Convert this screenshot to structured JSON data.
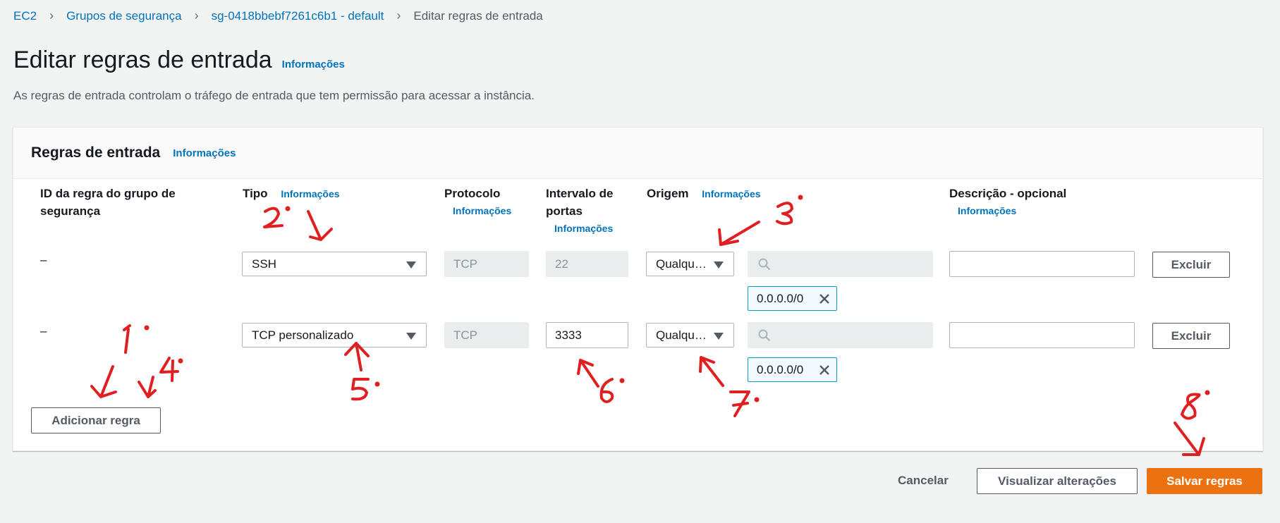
{
  "breadcrumb": {
    "items": [
      "EC2",
      "Grupos de segurança",
      "sg-0418bbebf7261c6b1 - default",
      "Editar regras de entrada"
    ]
  },
  "header": {
    "title": "Editar regras de entrada",
    "info": "Informações",
    "description": "As regras de entrada controlam o tráfego de entrada que tem permissão para acessar a instância."
  },
  "panel": {
    "title": "Regras de entrada",
    "info": "Informações",
    "columns": {
      "rule_id": "ID da regra do grupo de segurança",
      "type": "Tipo",
      "protocol": "Protocolo",
      "port_range": "Intervalo de portas",
      "source": "Origem",
      "description": "Descrição - opcional",
      "info": "Informações"
    },
    "rows": [
      {
        "id": "–",
        "type": "SSH",
        "protocol": "TCP",
        "port": "22",
        "source": "Qualqu…",
        "search": "",
        "cidr": "0.0.0.0/0",
        "description": "",
        "delete": "Excluir"
      },
      {
        "id": "–",
        "type": "TCP personalizado",
        "protocol": "TCP",
        "port": "3333",
        "source": "Qualqu…",
        "search": "",
        "cidr": "0.0.0.0/0",
        "description": "",
        "delete": "Excluir"
      }
    ],
    "add_rule": "Adicionar regra"
  },
  "footer": {
    "cancel": "Cancelar",
    "preview": "Visualizar alterações",
    "save": "Salvar regras"
  },
  "annotations": {
    "color": "#e02020",
    "labels": [
      "1.",
      "2.",
      "3.",
      "4.",
      "5.",
      "6.",
      "7.",
      "8."
    ]
  },
  "colors": {
    "link": "#0073bb",
    "primary": "#ec7211",
    "token_border": "#00a1c9"
  }
}
